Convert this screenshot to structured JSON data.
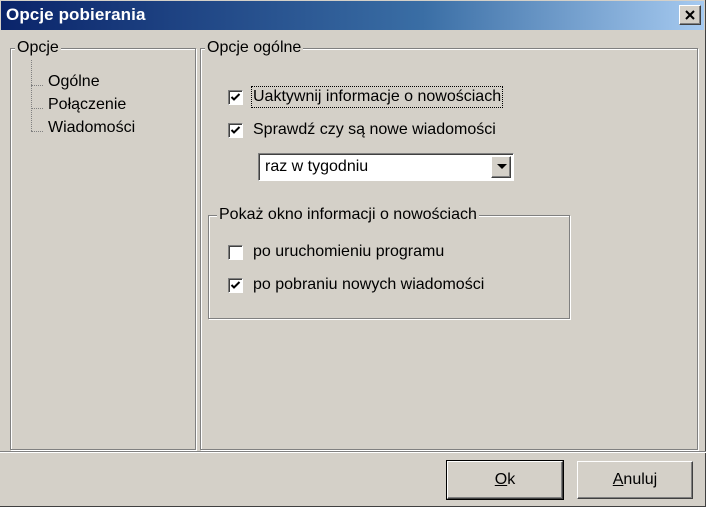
{
  "window": {
    "title": "Opcje pobierania"
  },
  "sidebar": {
    "group_label": "Opcje",
    "items": [
      {
        "label": "Ogólne"
      },
      {
        "label": "Połączenie"
      },
      {
        "label": "Wiadomości"
      }
    ]
  },
  "general": {
    "group_label": "Opcje ogólne",
    "enable_news": {
      "label": "Uaktywnij informacje o nowościach",
      "checked": true
    },
    "check_messages": {
      "label": "Sprawdź czy są nowe wiadomości",
      "checked": true
    },
    "frequency": {
      "selected": "raz w tygodniu"
    }
  },
  "news_window": {
    "group_label": "Pokaż okno informacji o nowościach",
    "on_startup": {
      "label": "po uruchomieniu programu",
      "checked": false
    },
    "after_download": {
      "label": "po pobraniu nowych wiadomości",
      "checked": true
    }
  },
  "buttons": {
    "ok_accel": "O",
    "ok_rest": "k",
    "cancel_accel": "A",
    "cancel_rest": "nuluj"
  }
}
